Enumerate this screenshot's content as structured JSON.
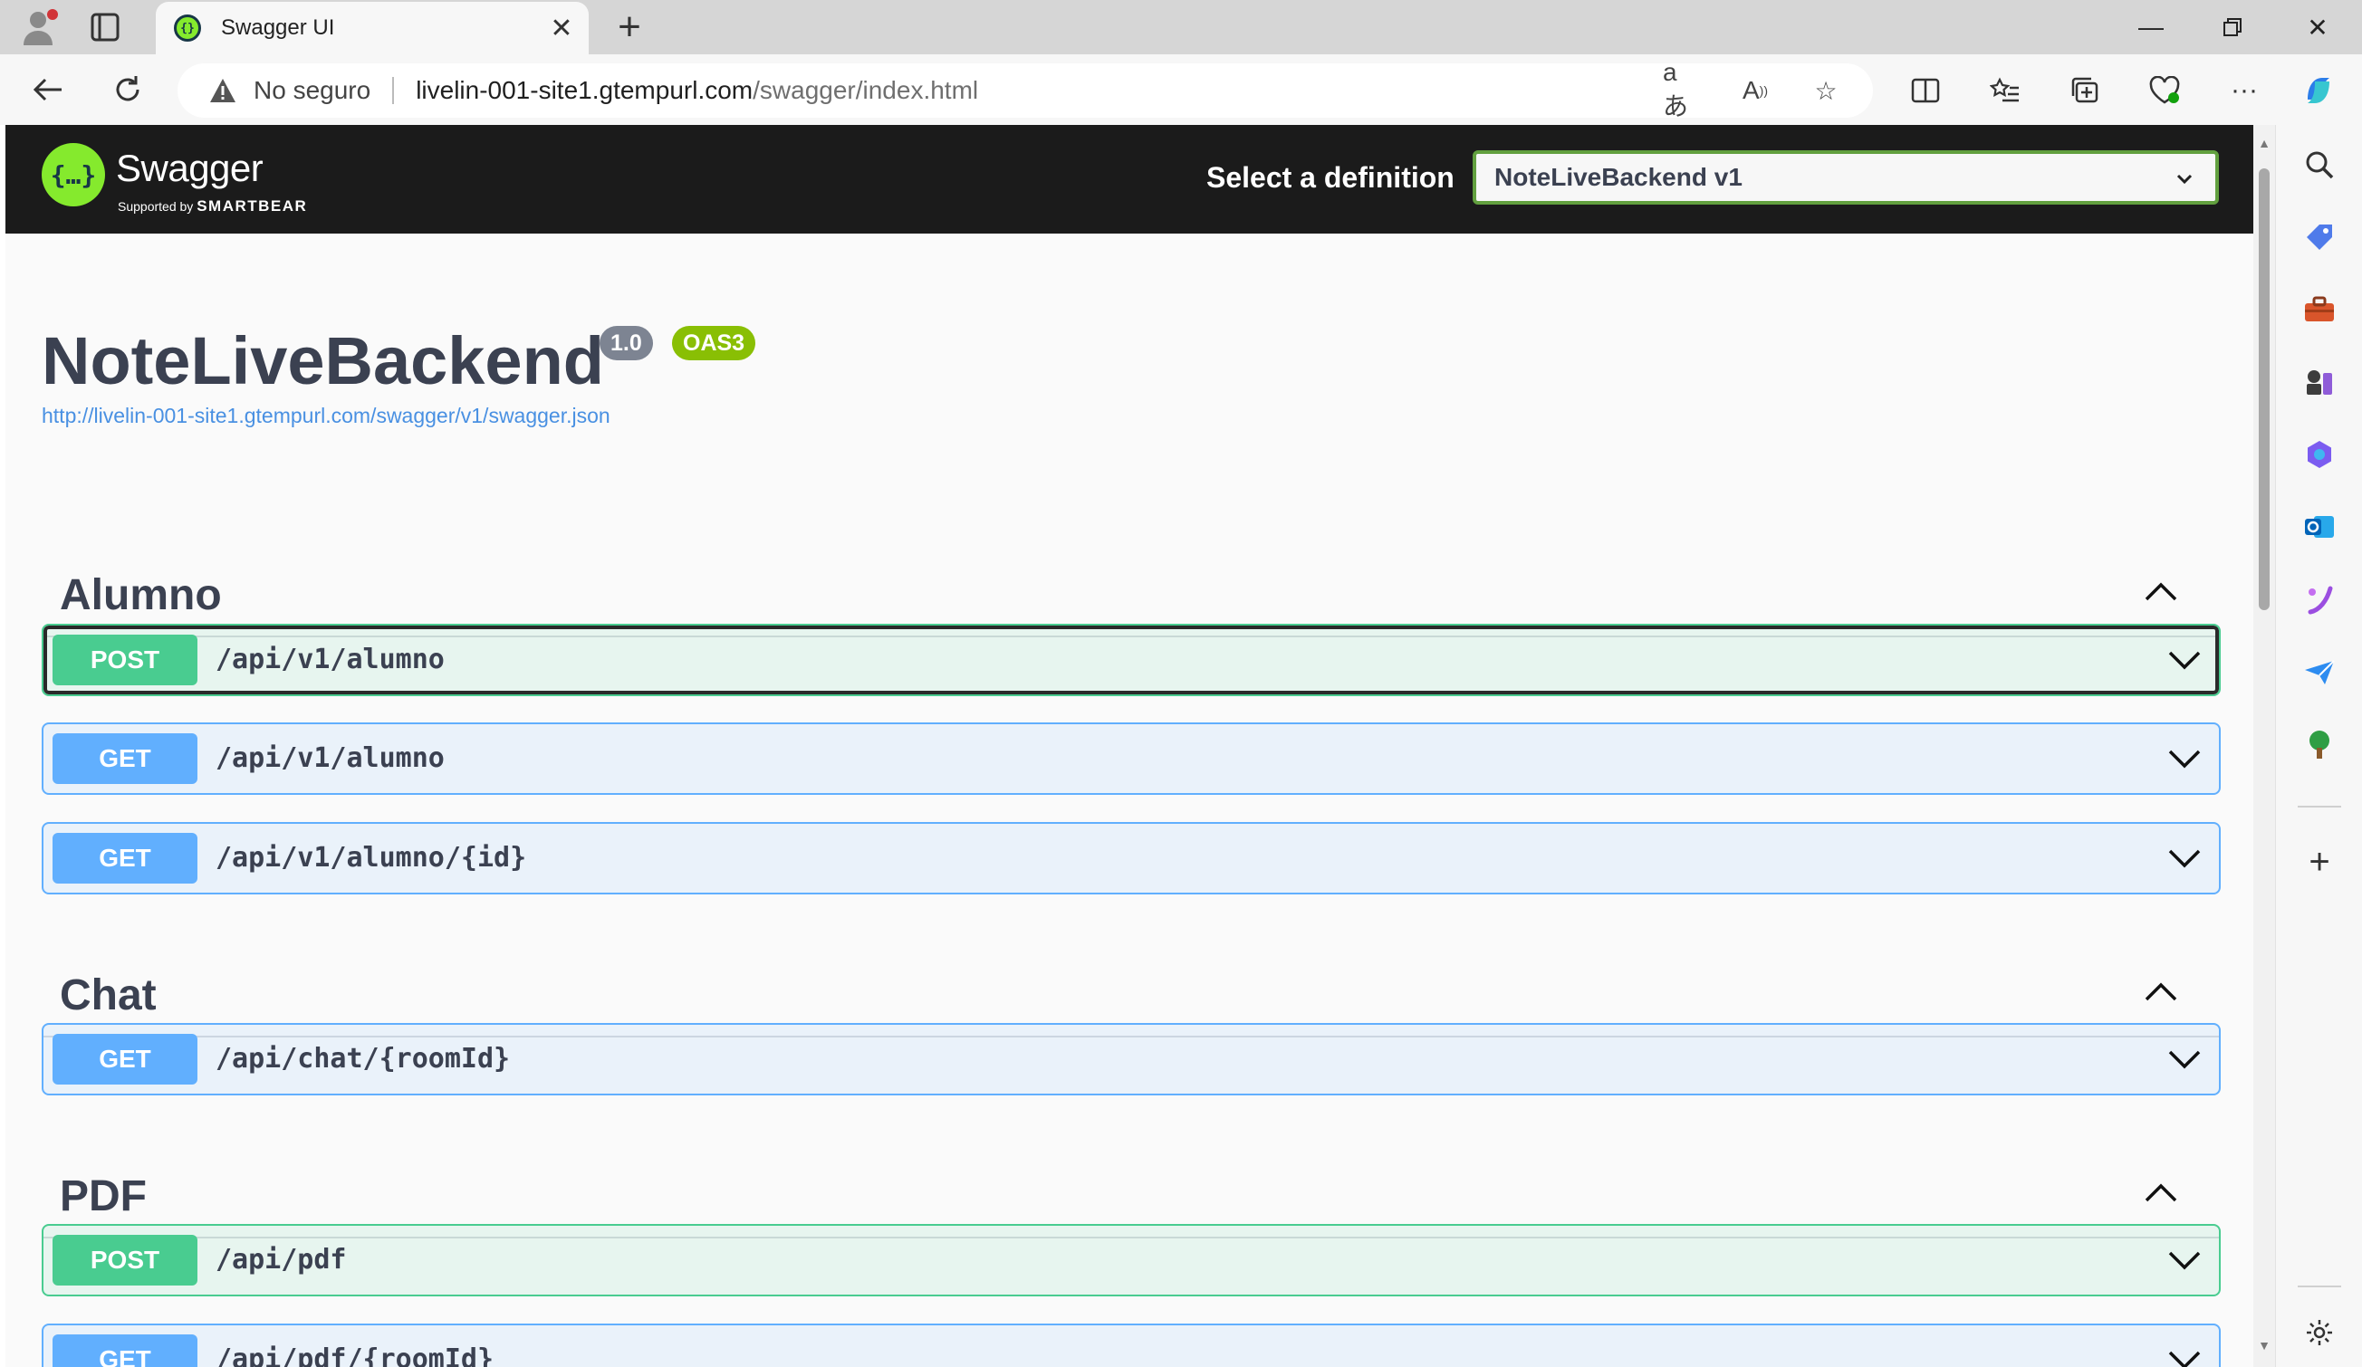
{
  "browser": {
    "tab_title": "Swagger UI",
    "security_label": "No seguro",
    "url_host": "livelin-001-site1.gtempurl.com",
    "url_path": "/swagger/index.html"
  },
  "swagger": {
    "brand": "Swagger",
    "supported_by": "Supported by",
    "smartbear": "SMARTBEAR",
    "select_label": "Select a definition",
    "selected_definition": "NoteLiveBackend v1"
  },
  "info": {
    "title": "NoteLiveBackend",
    "version": "1.0",
    "oas": "OAS3",
    "spec_url": "http://livelin-001-site1.gtempurl.com/swagger/v1/swagger.json"
  },
  "sections": [
    {
      "name": "Alumno",
      "operations": [
        {
          "method": "POST",
          "path": "/api/v1/alumno"
        },
        {
          "method": "GET",
          "path": "/api/v1/alumno"
        },
        {
          "method": "GET",
          "path": "/api/v1/alumno/{id}"
        }
      ]
    },
    {
      "name": "Chat",
      "operations": [
        {
          "method": "GET",
          "path": "/api/chat/{roomId}"
        }
      ]
    },
    {
      "name": "PDF",
      "operations": [
        {
          "method": "POST",
          "path": "/api/pdf"
        },
        {
          "method": "GET",
          "path": "/api/pdf/{roomId}"
        }
      ]
    }
  ],
  "colors": {
    "post": "#49cc90",
    "get": "#61affe",
    "topbar": "#1b1b1b",
    "swagger_green": "#85ea2d"
  }
}
